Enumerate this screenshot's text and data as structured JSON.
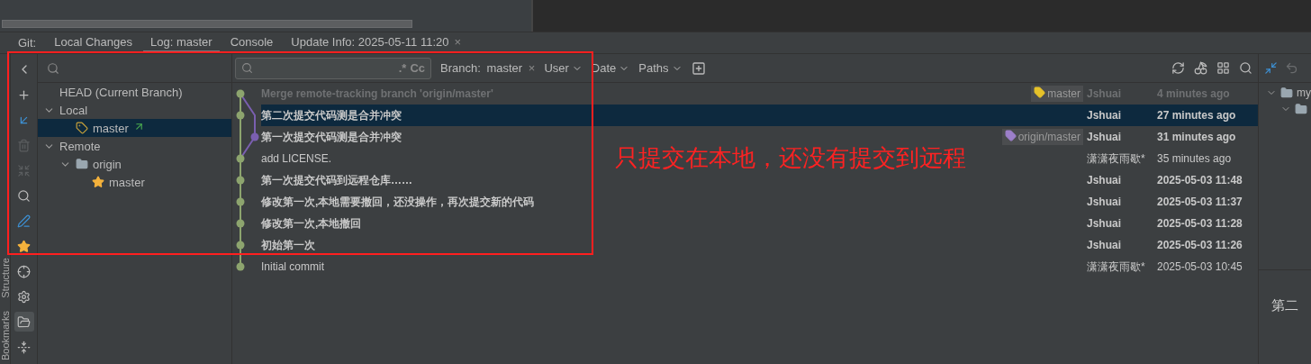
{
  "tool_window": {
    "label": "Git:",
    "tabs": [
      {
        "label": "Local Changes",
        "selected": false,
        "closable": false
      },
      {
        "label": "Log: master",
        "selected": true,
        "closable": false
      },
      {
        "label": "Console",
        "selected": false,
        "closable": false
      },
      {
        "label": "Update Info: 2025-05-11 11:20",
        "selected": false,
        "closable": true,
        "close": "×"
      }
    ]
  },
  "side_labels": [
    "Structure",
    "Bookmarks"
  ],
  "branches": {
    "items": [
      {
        "label": "HEAD (Current Branch)",
        "kind": "head",
        "selected": false
      },
      {
        "label": "Local",
        "kind": "group",
        "expanded": true,
        "selected": false,
        "children": [
          {
            "label": "master",
            "kind": "branch",
            "selected": true,
            "tracking": true
          }
        ]
      },
      {
        "label": "Remote",
        "kind": "group",
        "expanded": true,
        "selected": false,
        "children": [
          {
            "label": "origin",
            "kind": "folder",
            "expanded": true,
            "selected": false,
            "children": [
              {
                "label": "master",
                "kind": "favorite",
                "selected": false,
                "tracking": false
              }
            ]
          }
        ]
      }
    ]
  },
  "filters": {
    "search": {
      "regex": ".*",
      "case": "Cc"
    },
    "items": [
      {
        "label": "Branch:",
        "value": "master",
        "clear": "×"
      },
      {
        "label": "User"
      },
      {
        "label": "Date"
      },
      {
        "label": "Paths"
      }
    ]
  },
  "commits": [
    {
      "message": "Merge remote-tracking branch 'origin/master'",
      "author": "Jshuai",
      "date": "4 minutes ago",
      "side_branch": false,
      "bold": true,
      "dimmed": true,
      "selected": false,
      "refs": [
        {
          "label": "master",
          "color": "#e6c229"
        }
      ]
    },
    {
      "message": "第二次提交代码测是合并冲突",
      "author": "Jshuai",
      "date": "27 minutes ago",
      "side_branch": false,
      "bold": true,
      "dimmed": false,
      "selected": true
    },
    {
      "message": "第一次提交代码测是合并冲突",
      "author": "Jshuai",
      "date": "31 minutes ago",
      "side_branch": true,
      "bold": true,
      "dimmed": false,
      "selected": false,
      "refs": [
        {
          "label": "origin/master",
          "color": "#9c7fc9"
        }
      ]
    },
    {
      "message": "add LICENSE.",
      "author": "潇潇夜雨歇*",
      "date": "35 minutes ago",
      "side_branch": false,
      "bold": false,
      "dimmed": false,
      "selected": false
    },
    {
      "message": "第一次提交代码到远程仓库……",
      "author": "Jshuai",
      "date": "2025-05-03 11:48",
      "side_branch": false,
      "bold": true,
      "dimmed": false,
      "selected": false
    },
    {
      "message": "修改第一次,本地需要撤回，还没操作，再次提交新的代码",
      "author": "Jshuai",
      "date": "2025-05-03 11:37",
      "side_branch": false,
      "bold": true,
      "dimmed": false,
      "selected": false
    },
    {
      "message": "修改第一次,本地撤回",
      "author": "Jshuai",
      "date": "2025-05-03 11:28",
      "side_branch": false,
      "bold": true,
      "dimmed": false,
      "selected": false
    },
    {
      "message": "初始第一次",
      "author": "Jshuai",
      "date": "2025-05-03 11:26",
      "side_branch": false,
      "bold": true,
      "dimmed": false,
      "selected": false
    },
    {
      "message": "Initial commit",
      "author": "潇潇夜雨歇*",
      "date": "2025-05-03 10:45",
      "side_branch": false,
      "bold": false,
      "dimmed": false,
      "selected": false
    }
  ],
  "details": {
    "tree_root": "my",
    "heading": "第二"
  },
  "annotation": {
    "text": "只提交在本地，还没有提交到远程"
  }
}
